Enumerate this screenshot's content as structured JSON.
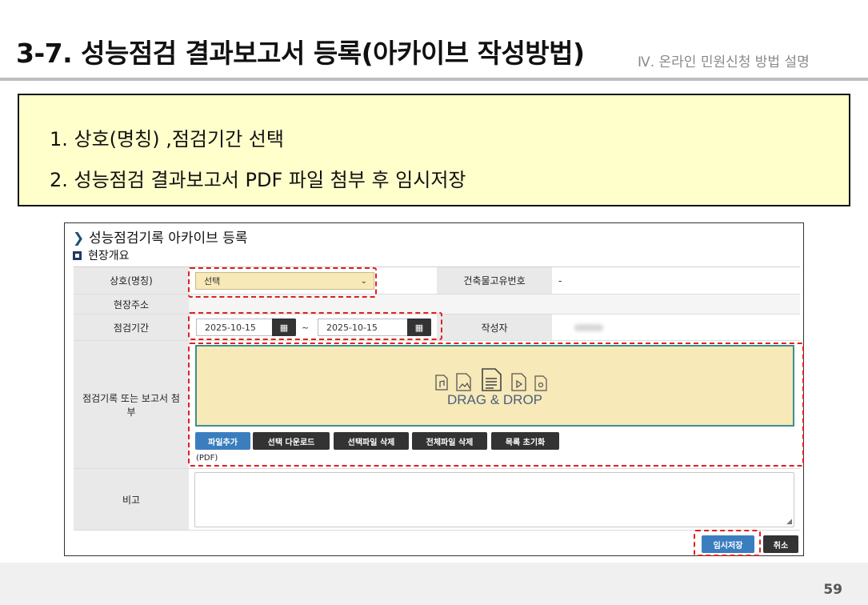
{
  "slide": {
    "title": "3-7. 성능점검 결과보고서 등록(아카이브 작성방법)",
    "section": "Ⅳ. 온라인 민원신청 방법 설명",
    "page_number": "59"
  },
  "instructions": {
    "line1": "1. 상호(명칭) ,점검기간 선택",
    "line2": "2. 성능점검 결과보고서 PDF 파일 첨부 후 임시저장"
  },
  "app": {
    "title": "성능점검기록 아카이브 등록",
    "section_title": "현장개요",
    "fields": {
      "company_label": "상호(명칭)",
      "company_value": "선택",
      "building_id_label": "건축물고유번호",
      "building_id_value": "-",
      "address_label": "현장주소",
      "period_label": "점검기간",
      "period_start": "2025-10-15",
      "period_separator": "~",
      "period_end": "2025-10-15",
      "author_label": "작성자",
      "attach_label": "점검기록 또는 보고서 첨부",
      "note_label": "비고"
    },
    "dropzone": {
      "text": "DRAG & DROP"
    },
    "file_buttons": {
      "add": "파일추가",
      "download_selected": "선택 다운로드",
      "delete_selected": "선택파일 삭제",
      "delete_all": "전체파일 삭제",
      "reset_list": "목록 초기화"
    },
    "file_type_note": "(PDF)",
    "actions": {
      "save_draft": "임시저장",
      "cancel": "취소"
    }
  },
  "colors": {
    "highlight_dash": "#e02020",
    "primary_button": "#3a7ebf",
    "dark_button": "#333333",
    "dropzone_bg": "#f7e9b8",
    "note_bg": "#ffffcc"
  }
}
